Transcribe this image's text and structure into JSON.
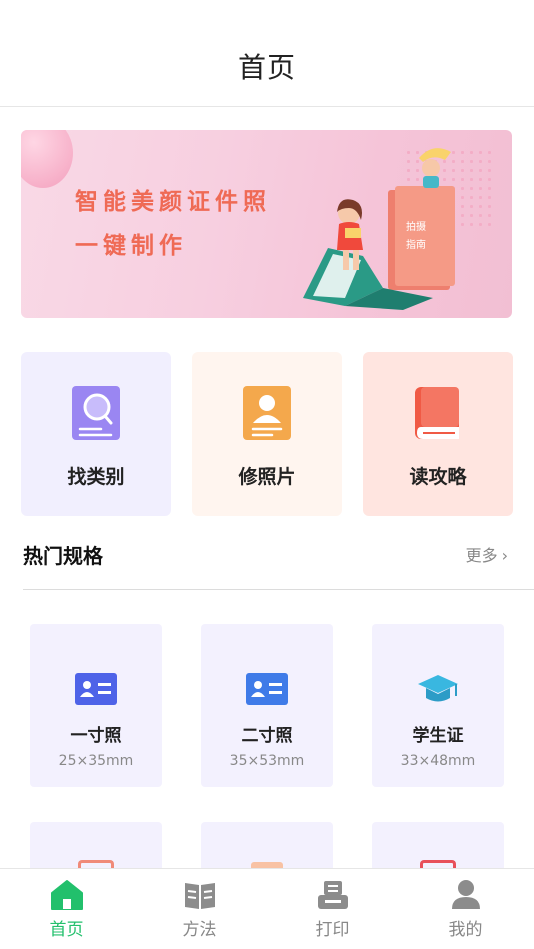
{
  "header": {
    "title": "首页"
  },
  "banner": {
    "line1": "智能美颜证件照",
    "line2": "一键制作",
    "book_text1": "拍摄",
    "book_text2": "指南"
  },
  "quick_cards": [
    {
      "label": "找类别",
      "icon": "search-card-icon"
    },
    {
      "label": "修照片",
      "icon": "person-card-icon"
    },
    {
      "label": "读攻略",
      "icon": "book-icon"
    }
  ],
  "hot": {
    "title": "热门规格",
    "more": "更多"
  },
  "specs": [
    {
      "name": "一寸照",
      "size": "25×35mm",
      "icon": "id-card-icon"
    },
    {
      "name": "二寸照",
      "size": "35×53mm",
      "icon": "id-card-icon"
    },
    {
      "name": "学生证",
      "size": "33×48mm",
      "icon": "graduation-cap-icon"
    }
  ],
  "tabbar": [
    {
      "label": "首页",
      "icon": "home-icon",
      "active": true
    },
    {
      "label": "方法",
      "icon": "method-icon",
      "active": false
    },
    {
      "label": "打印",
      "icon": "print-icon",
      "active": false
    },
    {
      "label": "我的",
      "icon": "profile-icon",
      "active": false
    }
  ],
  "colors": {
    "accent": "#22c06c",
    "banner_text": "#ef6a55",
    "spec_bg": "#f3f1fe"
  }
}
